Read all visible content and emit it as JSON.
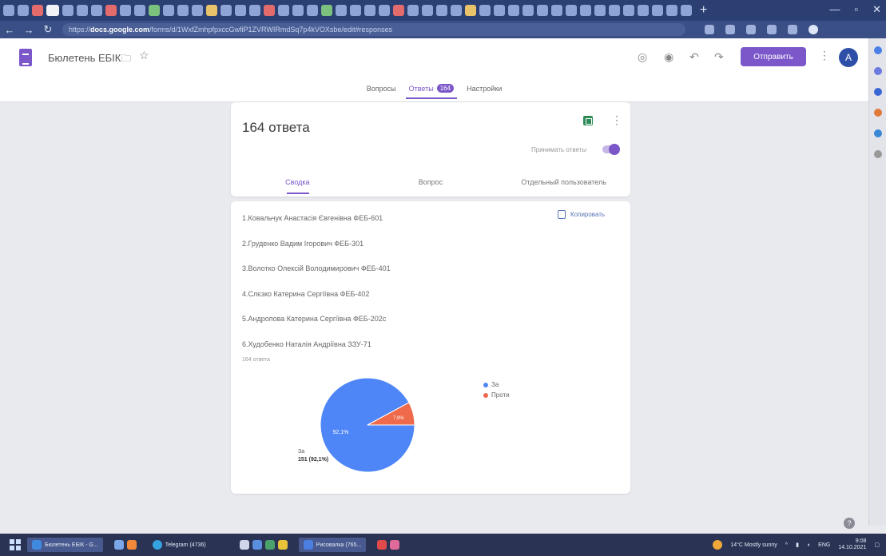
{
  "browser": {
    "url_prefix": "https://",
    "url_domain": "docs.google.com",
    "url_rest": "/forms/d/1WxfZmhpfpxccGwfiP1ZVRWIRmdSq7p4kVOXsbe/edit#responses"
  },
  "header": {
    "doc_title": "Бюлетень ЕБІК",
    "send_label": "Отправить",
    "avatar_letter": "A"
  },
  "nav": {
    "questions": "Вопросы",
    "responses": "Ответы",
    "responses_badge": "164",
    "settings": "Настройки"
  },
  "summary": {
    "count_title": "164 ответа",
    "accept_label": "Принимать ответы",
    "tabs": [
      "Сводка",
      "Вопрос",
      "Отдельный пользователь"
    ]
  },
  "question": {
    "lines": [
      "1.Ковальчук Анастасія Євгенівна ФЕБ-601",
      "2.Груденко Вадим Ігорович ФЕБ-301",
      "3.Волотко Олексій Володимирович ФЕБ-401",
      "4.Слєзко Катерина Сергіївна ФЕБ-402",
      "5.Андропова Катерина Сергіївна ФЕБ-202с",
      "6.Худобенко Наталія Андріївна ЗЗУ-71"
    ],
    "copy_label": "Копировать",
    "response_count": "164 ответа"
  },
  "chart_data": {
    "type": "pie",
    "series": [
      {
        "name": "За",
        "value": 92.1,
        "color": "#4f86f7"
      },
      {
        "name": "Проти",
        "value": 7.9,
        "color": "#ee6a4a"
      }
    ],
    "slice_labels": [
      "92,1%",
      "7,9%"
    ],
    "callout_name": "За",
    "callout_value": "151 (92,1%)"
  },
  "taskbar": {
    "apps": [
      "Бюлетень ЕБІК - G...",
      "Telegram (4736)",
      "Рисовалка (765..."
    ],
    "weather": "14°C Mostly sunny",
    "lang": "ENG",
    "time": "9:08",
    "date": "14.10.2021"
  }
}
